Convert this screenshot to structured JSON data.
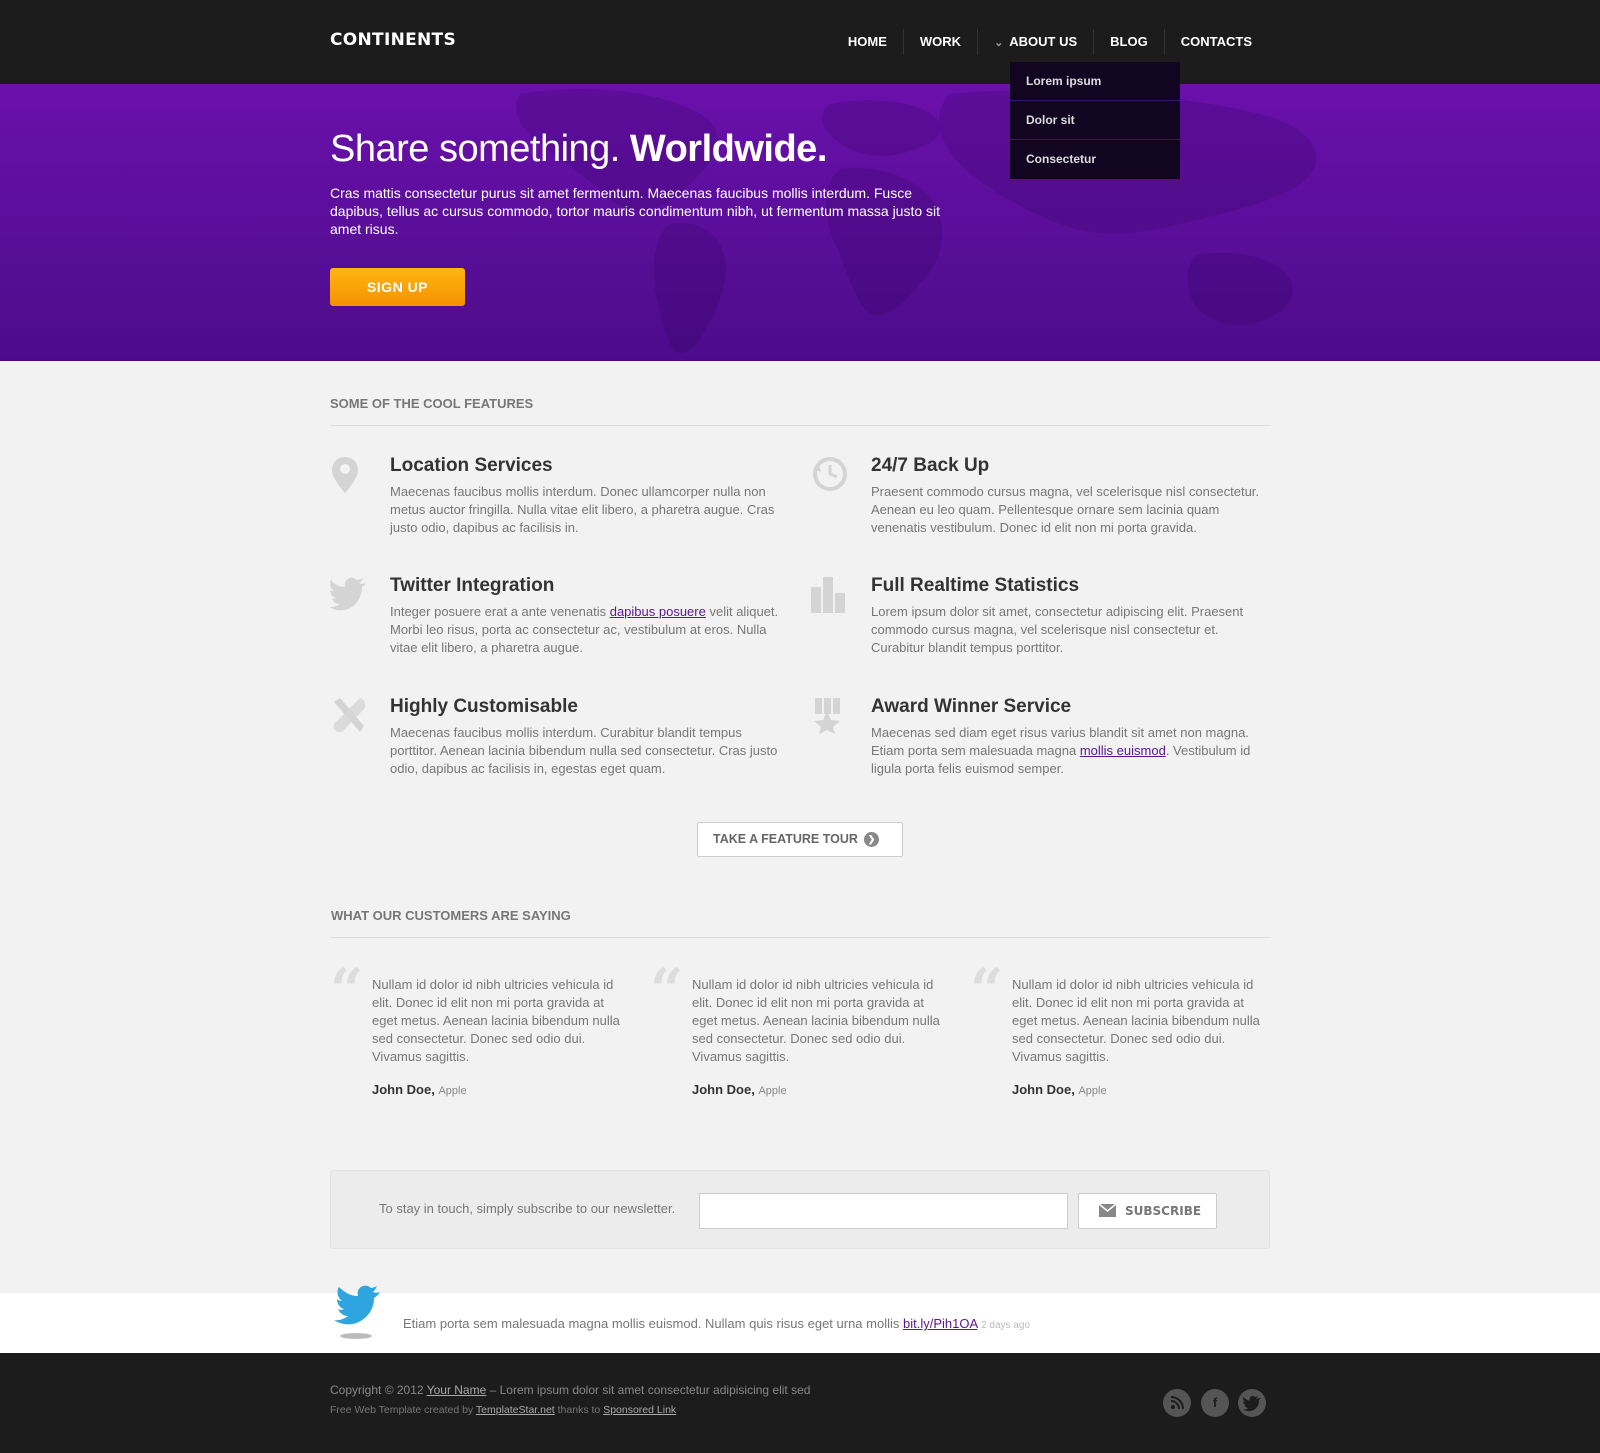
{
  "header": {
    "logo": "CONTINENTS",
    "nav": [
      "HOME",
      "WORK",
      "ABOUT US",
      "BLOG",
      "CONTACTS"
    ],
    "dropdown": [
      "Lorem ipsum",
      "Dolor sit",
      "Consectetur"
    ]
  },
  "hero": {
    "title_light": "Share something.",
    "title_bold": "Worldwide.",
    "text": "Cras mattis consectetur purus sit amet fermentum. Maecenas faucibus mollis interdum. Fusce dapibus, tellus ac cursus commodo, tortor mauris condimentum nibh, ut fermentum massa justo sit amet risus.",
    "signup_label": "SIGN UP"
  },
  "features": {
    "heading": "SOME OF THE COOL FEATURES",
    "items": [
      {
        "title": "Location Services",
        "text": "Maecenas faucibus mollis interdum. Donec ullamcorper nulla non metus auctor fringilla. Nulla vitae elit libero, a pharetra augue. Cras justo odio, dapibus ac facilisis in.",
        "icon": "location-pin-icon"
      },
      {
        "title": "24/7 Back Up",
        "text": "Praesent commodo cursus magna, vel scelerisque nisl consectetur. Aenean eu leo quam. Pellentesque ornare sem lacinia quam venenatis vestibulum. Donec id elit non mi porta gravida.",
        "icon": "clock-backup-icon"
      },
      {
        "title": "Twitter Integration",
        "text_before": "Integer posuere erat a ante venenatis ",
        "link": "dapibus posuere",
        "text_after": " velit aliquet. Morbi leo risus, porta ac consectetur ac, vestibulum at eros. Nulla vitae elit libero, a pharetra augue.",
        "icon": "twitter-bird-icon"
      },
      {
        "title": "Full Realtime Statistics",
        "text": "Lorem ipsum dolor sit amet, consectetur adipiscing elit. Praesent commodo cursus magna, vel scelerisque nisl consectetur et. Curabitur blandit tempus porttitor.",
        "icon": "bar-chart-icon"
      },
      {
        "title": "Highly Customisable",
        "text": "Maecenas faucibus mollis interdum. Curabitur blandit tempus porttitor. Aenean lacinia bibendum nulla sed consectetur. Cras justo  odio, dapibus ac facilisis in, egestas eget quam.",
        "icon": "tools-icon"
      },
      {
        "title": "Award Winner Service",
        "text_before": "Maecenas sed diam eget risus varius blandit sit amet non magna. Etiam porta sem malesuada magna ",
        "link": "mollis euismod",
        "text_after": ". Vestibulum id ligula porta felis euismod semper.",
        "icon": "award-ribbon-icon"
      }
    ],
    "tour_label": "TAKE A FEATURE TOUR"
  },
  "testimonials": {
    "heading": "WHAT OUR CUSTOMERS ARE SAYING",
    "items": [
      {
        "text": "Nullam id dolor id nibh ultricies vehicula id elit. Donec id elit non mi porta gravida at eget metus. Aenean lacinia bibendum nulla sed consectetur. Donec sed odio dui. Vivamus sagittis.",
        "name": "John Doe,",
        "company": "Apple"
      },
      {
        "text": "Nullam id dolor id nibh ultricies vehicula id elit. Donec id elit non mi porta gravida at eget metus. Aenean lacinia bibendum nulla sed consectetur. Donec sed odio dui. Vivamus sagittis.",
        "name": "John Doe,",
        "company": "Apple"
      },
      {
        "text": "Nullam id dolor id nibh ultricies vehicula id elit. Donec id elit non mi porta gravida at eget metus. Aenean lacinia bibendum nulla sed consectetur. Donec sed odio dui. Vivamus sagittis.",
        "name": "John Doe,",
        "company": "Apple"
      }
    ]
  },
  "newsletter": {
    "label": "To stay in touch, simply subscribe to our newsletter.",
    "input_value": "",
    "subscribe_label": "SUBSCRIBE"
  },
  "tweet": {
    "text": "Etiam porta sem malesuada magna mollis euismod. Nullam quis risus eget urna mollis",
    "link": "bit.ly/Pih1OA",
    "time": "2 days ago"
  },
  "footer": {
    "copyright_prefix": "Copyright © 2012",
    "your_name": "Your Name",
    "copyright_suffix": "– Lorem ipsum dolor sit amet consectetur adipisicing elit sed",
    "credit_prefix": "Free Web Template created by",
    "credit_link": "TemplateStar.net",
    "thanks": "thanks to",
    "sponsored": "Sponsored Link",
    "social": [
      "rss-icon",
      "facebook-icon",
      "twitter-icon"
    ]
  },
  "colors": {
    "hero_top": "#6a10ab",
    "hero_bottom": "#4c0c8a",
    "accent_orange": "#f59200",
    "dark_bg": "#1c1c1c",
    "link_purple": "#5a1690"
  }
}
